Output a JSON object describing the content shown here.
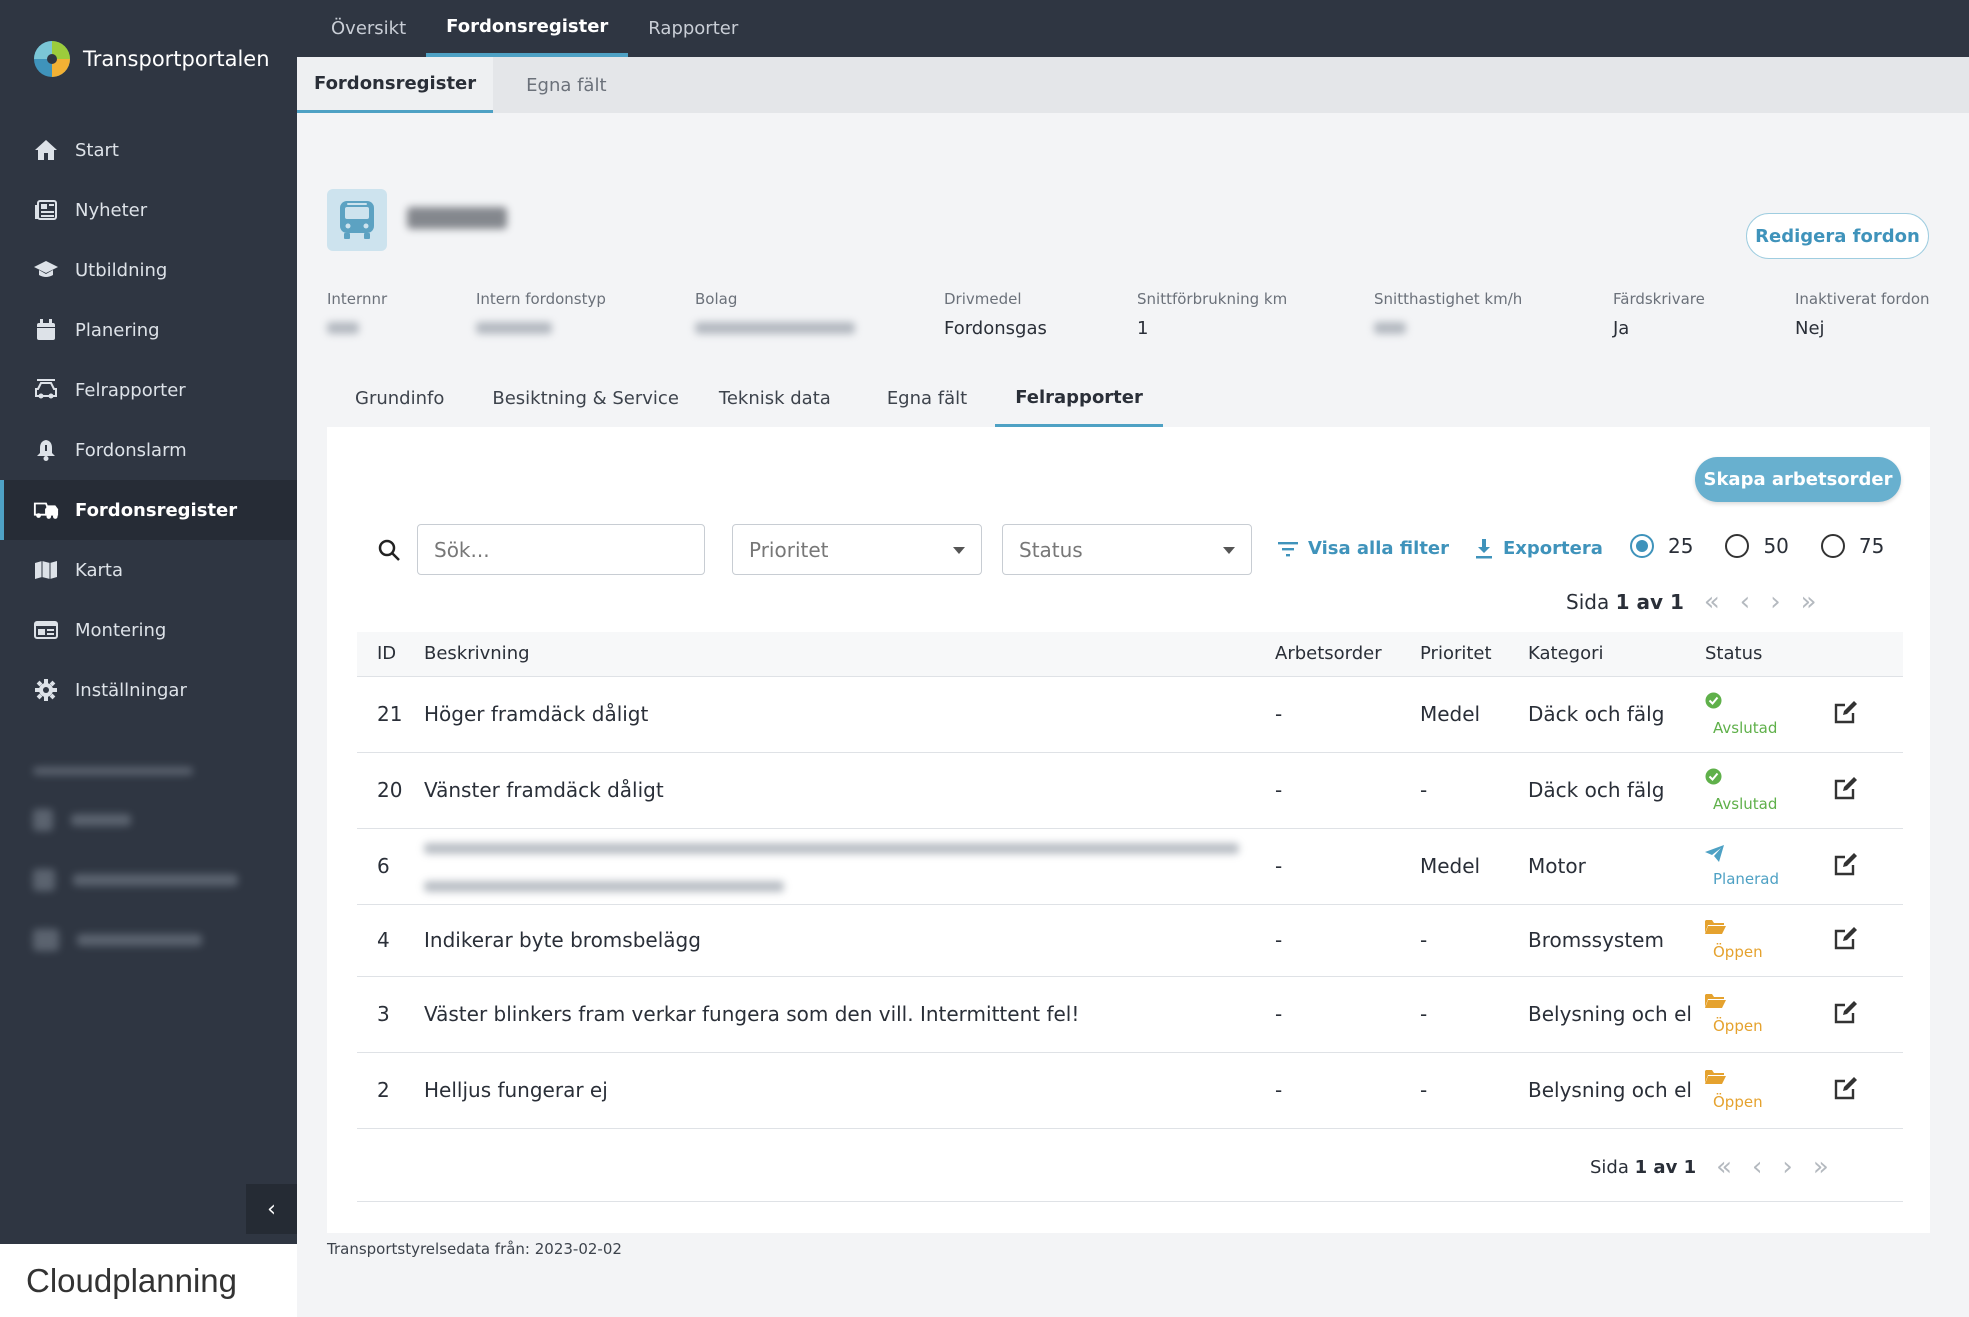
{
  "brand": {
    "name": "Transportportalen"
  },
  "sidebar": {
    "items": [
      {
        "label": "Start",
        "icon": "home-icon"
      },
      {
        "label": "Nyheter",
        "icon": "newspaper-icon"
      },
      {
        "label": "Utbildning",
        "icon": "graduation-cap-icon"
      },
      {
        "label": "Planering",
        "icon": "calendar-icon"
      },
      {
        "label": "Felrapporter",
        "icon": "car-fault-icon"
      },
      {
        "label": "Fordonslarm",
        "icon": "bell-icon"
      },
      {
        "label": "Fordonsregister",
        "icon": "vehicle-register-icon"
      },
      {
        "label": "Karta",
        "icon": "map-icon"
      },
      {
        "label": "Montering",
        "icon": "id-card-icon"
      },
      {
        "label": "Inställningar",
        "icon": "gear-icon"
      }
    ]
  },
  "footer_logo": "Cloudplanning",
  "topnav": {
    "tabs": [
      "Översikt",
      "Fordonsregister",
      "Rapporter"
    ],
    "active": 1
  },
  "subnav": {
    "tabs": [
      "Fordonsregister",
      "Egna fält"
    ],
    "active": 0
  },
  "vehicle": {
    "edit_label": "Redigera fordon",
    "fields": [
      {
        "label": "Internnr",
        "value": ""
      },
      {
        "label": "Intern fordonstyp",
        "value": ""
      },
      {
        "label": "Bolag",
        "value": ""
      },
      {
        "label": "Drivmedel",
        "value": "Fordonsgas"
      },
      {
        "label": "Snittförbrukning km",
        "value": "1"
      },
      {
        "label": "Snitthastighet km/h",
        "value": ""
      },
      {
        "label": "Färdskrivare",
        "value": "Ja"
      },
      {
        "label": "Inaktiverat fordon",
        "value": "Nej"
      }
    ]
  },
  "vehicle_tabs": {
    "tabs": [
      "Grundinfo",
      "Besiktning & Service",
      "Teknisk data",
      "Egna fält",
      "Felrapporter"
    ],
    "active": 4
  },
  "panel": {
    "create_label": "Skapa arbetsorder",
    "search_placeholder": "Sök...",
    "priority_placeholder": "Prioritet",
    "status_placeholder": "Status",
    "filter_label": "Visa alla filter",
    "export_label": "Exportera",
    "page_sizes": [
      "25",
      "50",
      "75"
    ],
    "page_size_selected": "25",
    "pager_prefix": "Sida",
    "pager_value": "1 av 1"
  },
  "table": {
    "headers": [
      "ID",
      "Beskrivning",
      "Arbetsorder",
      "Prioritet",
      "Kategori",
      "Status"
    ],
    "rows": [
      {
        "id": "21",
        "desc": "Höger framdäck dåligt",
        "order": "-",
        "prio": "Medel",
        "cat": "Däck och fälg",
        "status": "Avslutad",
        "stype": "ok"
      },
      {
        "id": "20",
        "desc": "Vänster framdäck dåligt",
        "order": "-",
        "prio": "-",
        "cat": "Däck och fälg",
        "status": "Avslutad",
        "stype": "ok"
      },
      {
        "id": "6",
        "desc": "",
        "order": "-",
        "prio": "Medel",
        "cat": "Motor",
        "status": "Planerad",
        "stype": "plan"
      },
      {
        "id": "4",
        "desc": "Indikerar byte bromsbelägg",
        "order": "-",
        "prio": "-",
        "cat": "Bromssystem",
        "status": "Öppen",
        "stype": "open"
      },
      {
        "id": "3",
        "desc": "Väster blinkers fram verkar fungera som den vill. Intermittent fel!",
        "order": "-",
        "prio": "-",
        "cat": "Belysning och el",
        "status": "Öppen",
        "stype": "open"
      },
      {
        "id": "2",
        "desc": "Helljus fungerar ej",
        "order": "-",
        "prio": "-",
        "cat": "Belysning och el",
        "status": "Öppen",
        "stype": "open"
      }
    ]
  },
  "footer_note": "Transportstyrelsedata från: 2023-02-02"
}
